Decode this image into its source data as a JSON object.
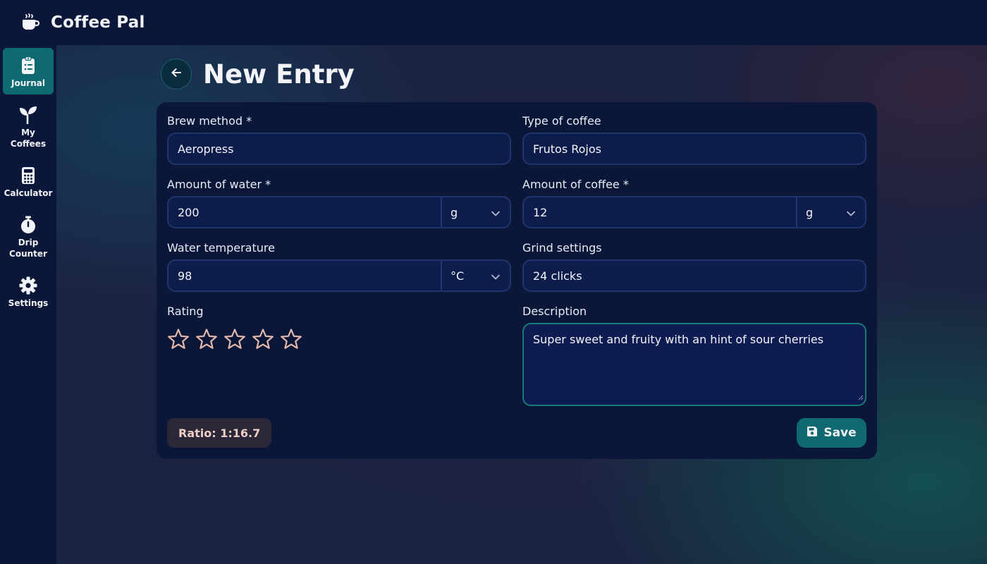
{
  "app": {
    "title": "Coffee Pal",
    "icon": "coffee-cup-icon"
  },
  "sidebar": {
    "items": [
      {
        "label": "Journal",
        "icon": "clipboard-list-icon",
        "active": true
      },
      {
        "label": "My\nCoffees",
        "icon": "seedling-icon",
        "active": false
      },
      {
        "label": "Calculator",
        "icon": "calculator-icon",
        "active": false
      },
      {
        "label": "Drip\nCounter",
        "icon": "stopwatch-icon",
        "active": false
      },
      {
        "label": "Settings",
        "icon": "gear-icon",
        "active": false
      }
    ]
  },
  "page": {
    "title": "New Entry",
    "back_icon": "arrow-left-icon"
  },
  "form": {
    "brew_method": {
      "label": "Brew method *",
      "value": "Aeropress"
    },
    "coffee_type": {
      "label": "Type of coffee",
      "value": "Frutos Rojos"
    },
    "water_amount": {
      "label": "Amount of water *",
      "value": "200",
      "unit": "g"
    },
    "coffee_amount": {
      "label": "Amount of coffee *",
      "value": "12",
      "unit": "g"
    },
    "water_temperature": {
      "label": "Water temperature",
      "value": "98",
      "unit": "°C"
    },
    "grind_settings": {
      "label": "Grind settings",
      "value": "24 clicks"
    },
    "rating": {
      "label": "Rating",
      "value": 0,
      "max": 5
    },
    "description": {
      "label": "Description",
      "value": "Super sweet and fruity with an hint of sour cherries"
    }
  },
  "ratio": {
    "text": "Ratio: 1:16.7"
  },
  "actions": {
    "save_label": "Save",
    "save_icon": "floppy-disk-icon"
  },
  "colors": {
    "accent": "#0e6a70",
    "background": "#0b1739",
    "input": "#0e1c4c",
    "star": "#e3b9ab"
  }
}
